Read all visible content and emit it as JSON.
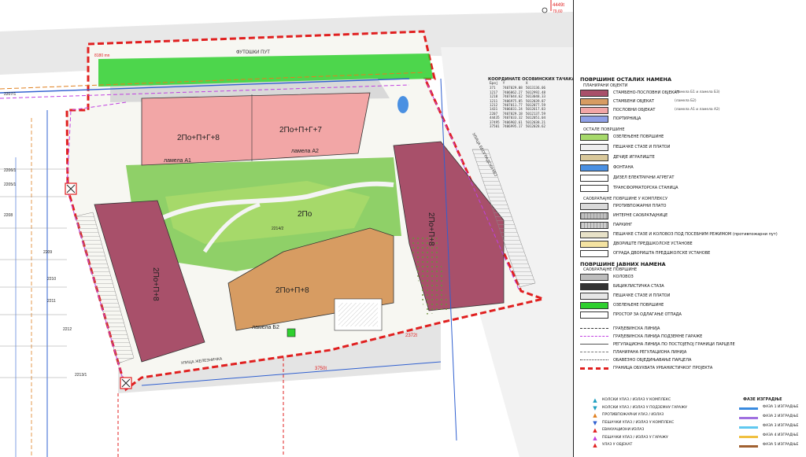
{
  "top_marker": {
    "label": "4449t",
    "elevation": "79,60"
  },
  "street_labels": {
    "top": "ФУТОШКИ ПУТ",
    "bottom": "УЛИЦА ЖЕЛЕЗНИЧКА",
    "right": "УЛИЦА БЕОГРАДСКИ КЕЈ"
  },
  "parcels": [
    "2207/1",
    "2206/1",
    "2205/1",
    "2208",
    "2209",
    "2210",
    "2211",
    "2212",
    "2213/1",
    "2214/2"
  ],
  "buildings": [
    {
      "label": "2По+П+Г+8",
      "sub": "ламела А1"
    },
    {
      "label": "2По+П+Г+7",
      "sub": "ламела А2"
    },
    {
      "label": "2По+П+8",
      "sub": ""
    },
    {
      "label": "2По+П+8",
      "sub": "ламела Б2"
    },
    {
      "label": "2По+П+8",
      "sub": ""
    },
    {
      "label": "2По",
      "sub": ""
    }
  ],
  "markers": {
    "bottom_left": "3750t",
    "bottom_right": "2372t",
    "dim_top": "8180 mn"
  },
  "coordinates": {
    "title": "КООРДИНАТЕ ОСОВИНСКИХ ТАЧАКА",
    "headers": [
      "Број",
      "Y",
      "X"
    ],
    "rows": [
      [
        "371",
        "7407029.08",
        "5013136.06"
      ],
      [
        "1217",
        "7406862.27",
        "5012992.48"
      ],
      [
        "1218",
        "7407044.62",
        "5013048.33"
      ],
      [
        "1211",
        "7406975.85",
        "5012039.87"
      ],
      [
        "1212",
        "7407011.77",
        "5012077.59"
      ],
      [
        "1431",
        "7406831.24",
        "5012617.83"
      ],
      [
        "2207",
        "7407029.18",
        "5012137.59"
      ],
      [
        "44435",
        "7407033.32",
        "5012051.04"
      ],
      [
        "37495",
        "7406902.61",
        "5012038.21"
      ],
      [
        "37501",
        "7406995.17",
        "5012028.62"
      ]
    ]
  },
  "legend": {
    "section1_title": "ПОВРШИНЕ ОСТАЛИХ НАМЕНА",
    "section1_sub": "ПЛАНИРАНИ ОБЈЕКТИ",
    "planned": [
      {
        "label": "СТАМБЕНО-ПОСЛОВНИ ОБЈЕКАТ",
        "note": "(ламела Б1 и ламела Б3)",
        "color": "#a8506a"
      },
      {
        "label": "СТАМБЕНИ ОБЈЕКАТ",
        "note": "(ламела Б2)",
        "color": "#d79c62"
      },
      {
        "label": "ПОСЛОВНИ ОБЈЕКАТ",
        "note": "(ламела А1 и ламела А2)",
        "color": "#f2a6a6"
      },
      {
        "label": "ПОРТИРНИЦА",
        "note": "",
        "color": "#8fa0e6"
      }
    ],
    "other_title": "ОСТАЛЕ ПОВРШИНЕ",
    "other": [
      {
        "label": "ОЗЕЛЕЊЕНЕ ПОВРШИНЕ",
        "color": "#a6d96a"
      },
      {
        "label": "ПЕШАЧКЕ СТАЗЕ И ПЛАТОИ",
        "color": "#eeeeee"
      },
      {
        "label": "ДЕЧИЈЕ ИГРАЛИШТЕ",
        "color": "#d9c89a"
      },
      {
        "label": "ФОНТАНА",
        "color": "#4a90e2"
      },
      {
        "label": "ДИЗЕЛ ЕЛЕКТРИЧНИ АГРЕГАТ",
        "color": "#ffffff"
      },
      {
        "label": "ТРАНСФОРМАТОРСКА СТАНИЦА",
        "color": "#ffffff"
      }
    ],
    "traffic_title": "САОБРАЋАЈНЕ ПОВРШИНЕ У КОМПЛЕКСУ",
    "traffic": [
      {
        "label": "ПРОТИВПОЖАРНИ ПЛАТО",
        "color": "#d9d9d9"
      },
      {
        "label": "ИНТЕРНЕ САОБРАЋАЈНИЦЕ",
        "color": "#bfbfbf"
      },
      {
        "label": "ПАРКИНГ",
        "color": "#cccccc"
      },
      {
        "label": "ПЕШАЧКЕ СТАЗЕ И КОЛОВОЗ ПОД ПОСЕБНИМ РЕЖИМОМ (противпожарни пут)",
        "color": "#e8e2c8"
      },
      {
        "label": "ДВОРИШТЕ ПРЕДШКОЛСКЕ УСТАНОВЕ",
        "color": "#f4e3a1"
      },
      {
        "label": "ОГРАДА ДВОРИШТА ПРЕДШКОЛСКЕ УСТАНОВЕ",
        "color": "#ffffff"
      }
    ],
    "public_title": "ПОВРШИНЕ ЈАВНИХ НАМЕНА",
    "public_sub": "САОБРАЋАЈНЕ ПОВРШИНЕ",
    "public": [
      {
        "label": "КОЛОВОЗ",
        "color": "#bdbdbd"
      },
      {
        "label": "БИЦИКЛИСТИЧКА СТАЗА",
        "color": "#333333"
      },
      {
        "label": "ПЕШАЧКЕ СТАЗЕ И ПЛАТОИ",
        "color": "#e6e6e6"
      },
      {
        "label": "ОЗЕЛЕЊЕНЕ ПОВРШИНЕ",
        "color": "#2fd02f"
      },
      {
        "label": "ПРОСТОР ЗА ОДЛАГАЊЕ ОТПАДА",
        "color": "#ffffff"
      }
    ],
    "lines": [
      {
        "label": "ГРАЂЕВИНСКА ЛИНИЈА",
        "color": "#333333",
        "style": "dashed"
      },
      {
        "label": "ГРАЂЕВИНСКА ЛИНИЈА ПОДЗЕМНЕ ГАРАЖЕ",
        "color": "#c040e0",
        "style": "dashed"
      },
      {
        "label": "РЕГУЛАЦИОНА ЛИНИЈА ПО ПОСТОЈЕЋОЈ ГРАНИЦИ ПАРЦЕЛЕ",
        "color": "#555555",
        "style": "solid"
      },
      {
        "label": "ПЛАНИРАНА РЕГУЛАЦИОНА ЛИНИЈА",
        "color": "#777777",
        "style": "dashdot"
      },
      {
        "label": "ОБАВЕЗНО ОБЈЕДИЊАВАЊЕ ПАРЦЕЛА",
        "color": "#333333",
        "style": "dotted"
      },
      {
        "label": "ГРАНИЦА ОБУХВАТА УРБАНИСТИЧКОГ ПРОЈЕКТА",
        "color": "#e02020",
        "style": "thickdash"
      }
    ],
    "entrances": [
      {
        "label": "КОЛСКИ УЛАЗ / ИЗЛАЗ У КОМПЛЕКС",
        "color": "#20a0c0",
        "glyph": "▲"
      },
      {
        "label": "КОЛСКИ УЛАЗ / ИЗЛАЗ У ПОДЗЕМНУ ГАРАЖУ",
        "color": "#20a0c0",
        "glyph": "▼"
      },
      {
        "label": "ПРОТИВПОЖАРНИ УЛАЗ / ИЗЛАЗ",
        "color": "#e08020",
        "glyph": "▲"
      },
      {
        "label": "ПЕШАЧКИ УЛАЗ / ИЗЛАЗ У КОМПЛЕКС",
        "color": "#3060d0",
        "glyph": "▼"
      },
      {
        "label": "ЕВАКУАЦИОНИ ИЗЛАЗ",
        "color": "#e02020",
        "glyph": "▲"
      },
      {
        "label": "ПЕШАЧКИ УЛАЗ / ИЗЛАЗ У ГАРАЖУ",
        "color": "#c040e0",
        "glyph": "▲"
      },
      {
        "label": "УЛАЗ У ОБЈЕКАТ",
        "color": "#e02020",
        "glyph": "▲"
      }
    ],
    "phases_title": "ФАЗЕ ИЗГРАДЊЕ",
    "phases": [
      {
        "label": "ФАЗА 1 ИЗГРАДЊЕ",
        "color": "#3a8be0"
      },
      {
        "label": "ФАЗА 2 ИЗГРАДЊЕ",
        "color": "#a070e0"
      },
      {
        "label": "ФАЗА 3 ИЗГРАДЊЕ",
        "color": "#60c8f0"
      },
      {
        "label": "ФАЗА 4 ИЗГРАДЊЕ",
        "color": "#f0c040"
      },
      {
        "label": "ФАЗА 5 ИЗГРАДЊЕ",
        "color": "#a06030"
      }
    ]
  }
}
